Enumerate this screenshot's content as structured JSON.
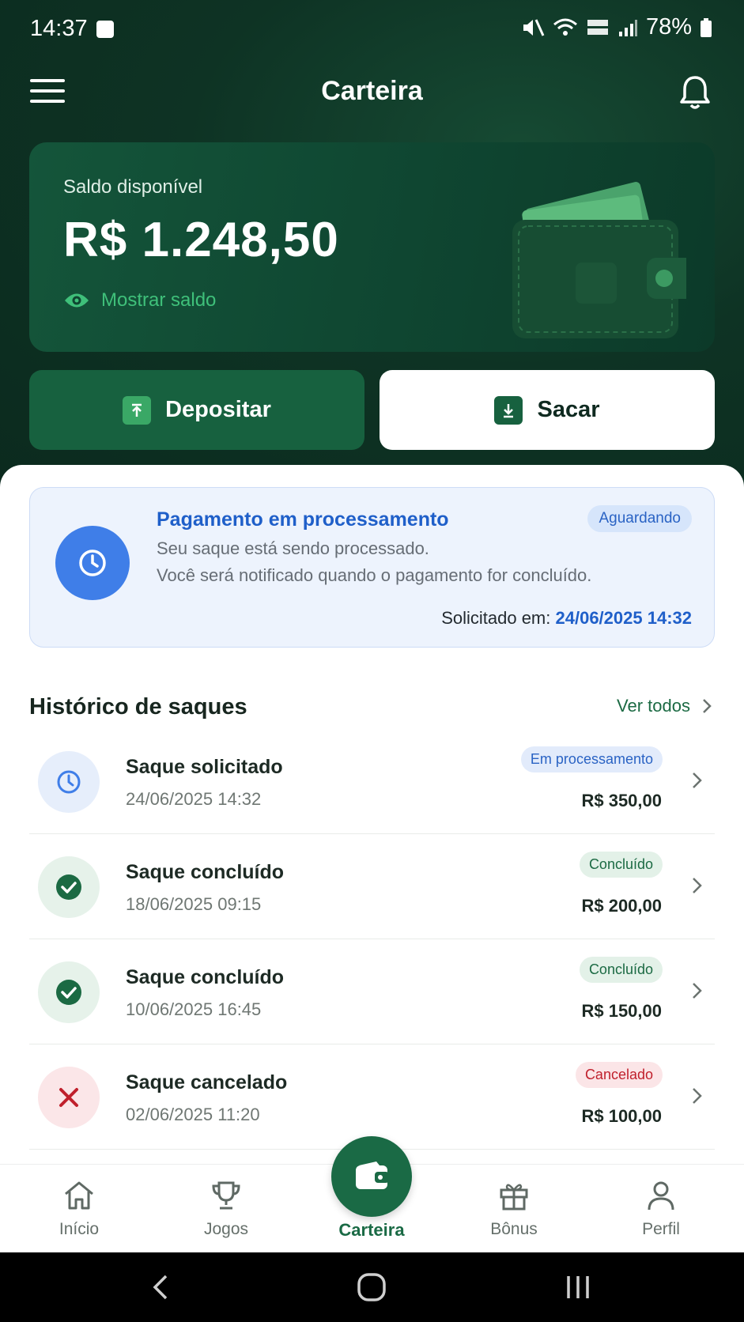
{
  "status_bar": {
    "time": "14:37",
    "battery": "78%"
  },
  "header": {
    "title": "Carteira"
  },
  "balance": {
    "label": "Saldo disponível",
    "amount": "R$ 1.248,50",
    "show_label": "Mostrar saldo"
  },
  "actions": {
    "deposit": "Depositar",
    "withdraw": "Sacar"
  },
  "processing": {
    "title": "Pagamento em processamento",
    "badge": "Aguardando",
    "line1": "Seu saque está sendo processado.",
    "line2": "Você será notificado quando o pagamento for concluído.",
    "requested_label": "Solicitado em:",
    "requested_value": "24/06/2025 14:32"
  },
  "history": {
    "title": "Histórico de saques",
    "see_all": "Ver todos",
    "items": [
      {
        "title": "Saque solicitado",
        "date": "24/06/2025 14:32",
        "status": "Em processamento",
        "amount": "R$ 350,00",
        "kind": "pending"
      },
      {
        "title": "Saque concluído",
        "date": "18/06/2025 09:15",
        "status": "Concluído",
        "amount": "R$ 200,00",
        "kind": "done"
      },
      {
        "title": "Saque concluído",
        "date": "10/06/2025 16:45",
        "status": "Concluído",
        "amount": "R$ 150,00",
        "kind": "done"
      },
      {
        "title": "Saque cancelado",
        "date": "02/06/2025 11:20",
        "status": "Cancelado",
        "amount": "R$ 100,00",
        "kind": "cancelled"
      }
    ]
  },
  "nav": {
    "items": [
      {
        "label": "Início",
        "icon": "home-icon"
      },
      {
        "label": "Jogos",
        "icon": "trophy-icon"
      },
      {
        "label": "Carteira",
        "icon": "wallet-icon"
      },
      {
        "label": "Bônus",
        "icon": "gift-icon"
      },
      {
        "label": "Perfil",
        "icon": "user-icon"
      }
    ]
  },
  "colors": {
    "brand": "#1a6a45",
    "processing_blue": "#3f7ee8",
    "success": "#1b6a43",
    "danger": "#c0202c"
  }
}
